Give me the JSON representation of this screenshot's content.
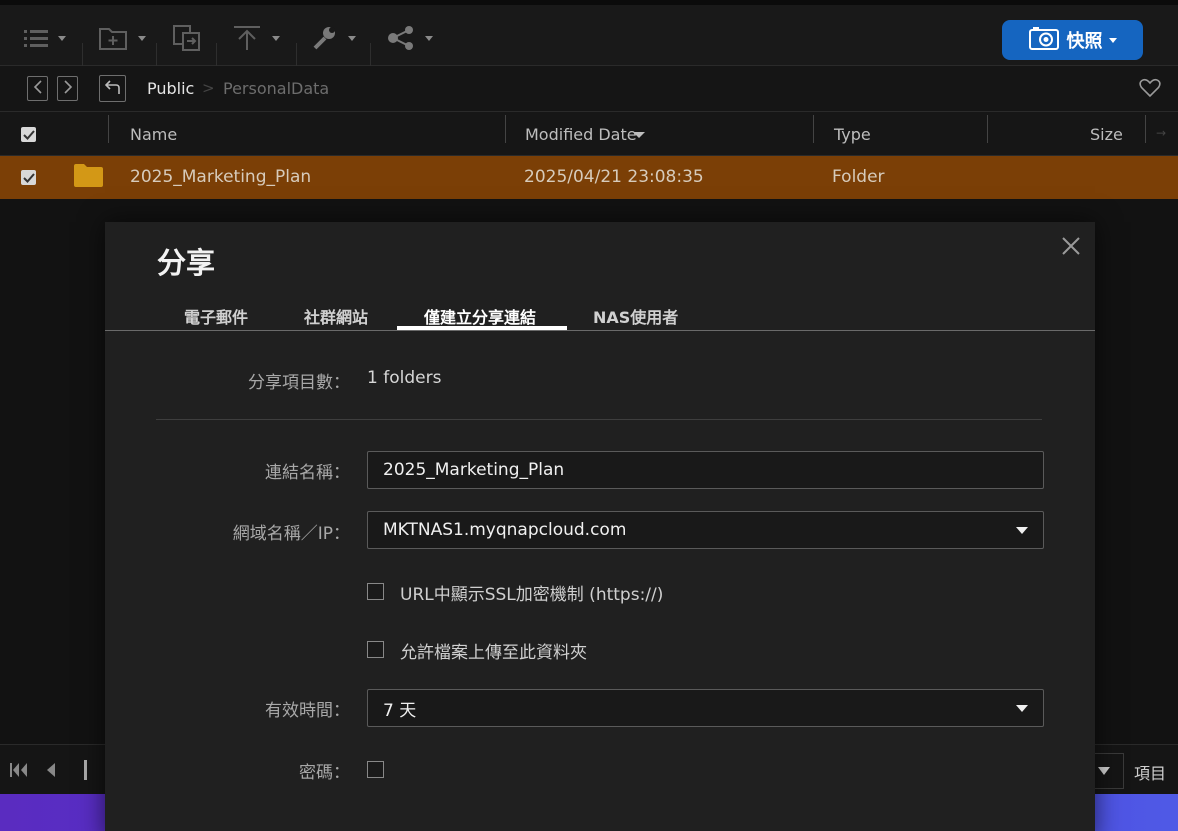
{
  "toolbar": {
    "icons": [
      "list-view-icon",
      "new-folder-icon",
      "copy-icon",
      "upload-icon",
      "tools-icon",
      "share-icon"
    ],
    "snapshot_label": "快照"
  },
  "breadcrumb": {
    "items": [
      "Public",
      "PersonalData"
    ],
    "separator": ">"
  },
  "table": {
    "columns": [
      "Name",
      "Modified Date",
      "Type",
      "Size"
    ],
    "rows": [
      {
        "name": "2025_Marketing_Plan",
        "modified": "2025/04/21 23:08:35",
        "type": "Folder",
        "size": "",
        "selected": true
      }
    ]
  },
  "pager": {
    "items_label": "項目"
  },
  "dialog": {
    "title": "分享",
    "tabs": [
      {
        "label": "電子郵件",
        "active": false
      },
      {
        "label": "社群網站",
        "active": false
      },
      {
        "label": "僅建立分享連結",
        "active": true
      },
      {
        "label": "NAS使用者",
        "active": false
      }
    ],
    "share_count_label": "分享項目數：",
    "share_count_value": "1 folders",
    "link_name_label": "連結名稱：",
    "link_name_value": "2025_Marketing_Plan",
    "domain_label": "網域名稱／IP：",
    "domain_value": "MKTNAS1.myqnapcloud.com",
    "ssl_label": "URL中顯示SSL加密機制 (https://)",
    "ssl_checked": false,
    "upload_label": "允許檔案上傳至此資料夾",
    "upload_checked": false,
    "expire_label": "有效時間：",
    "expire_value": "7 天",
    "password_label": "密碼：",
    "password_checked": false
  },
  "colors": {
    "selected_row": "#7b3f06",
    "snapshot_button": "#1565c0",
    "dialog_bg": "#202020",
    "bottom_strip": "#4b35d8"
  }
}
